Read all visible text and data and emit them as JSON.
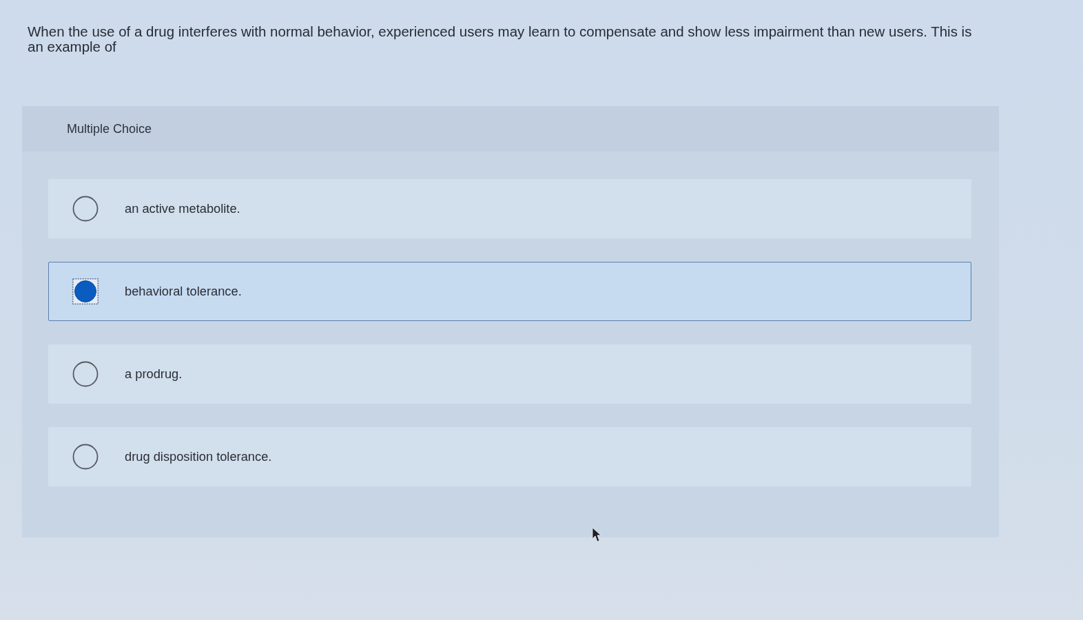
{
  "question": "When the use of a drug interferes with normal behavior, experienced users may learn to compensate and show less impairment than new users. This is an example of",
  "card": {
    "heading": "Multiple Choice",
    "options": [
      {
        "label": "an active metabolite.",
        "selected": false
      },
      {
        "label": "behavioral tolerance.",
        "selected": true
      },
      {
        "label": "a prodrug.",
        "selected": false
      },
      {
        "label": "drug disposition tolerance.",
        "selected": false
      }
    ]
  }
}
